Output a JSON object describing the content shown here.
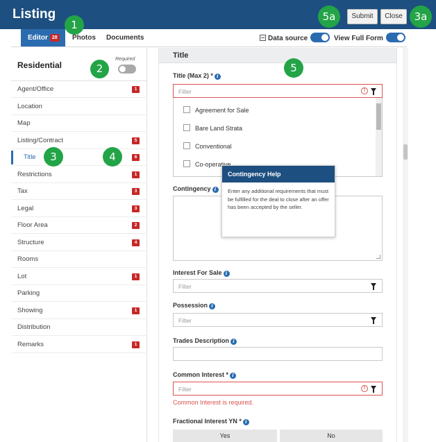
{
  "header": {
    "title": "Listing",
    "submit_label": "Submit",
    "close_label": "Close"
  },
  "tabs": [
    {
      "label": "Editor",
      "badge": "28"
    },
    {
      "label": "Photos"
    },
    {
      "label": "Documents"
    }
  ],
  "toggles": {
    "data_source_label": "Data source",
    "view_full_form_label": "View Full Form"
  },
  "sidebar": {
    "title": "Residential",
    "required_label": "Required",
    "items": [
      {
        "label": "Agent/Office",
        "badge": "1"
      },
      {
        "label": "Location",
        "badge": ""
      },
      {
        "label": "Map",
        "badge": ""
      },
      {
        "label": "Listing/Contract",
        "badge": "5"
      },
      {
        "label": "Title",
        "badge": "6"
      },
      {
        "label": "Restrictions",
        "badge": "1"
      },
      {
        "label": "Tax",
        "badge": "3"
      },
      {
        "label": "Legal",
        "badge": "3"
      },
      {
        "label": "Floor Area",
        "badge": "2"
      },
      {
        "label": "Structure",
        "badge": "4"
      },
      {
        "label": "Rooms",
        "badge": ""
      },
      {
        "label": "Lot",
        "badge": "1"
      },
      {
        "label": "Parking",
        "badge": ""
      },
      {
        "label": "Showing",
        "badge": "1"
      },
      {
        "label": "Distribution",
        "badge": ""
      },
      {
        "label": "Remarks",
        "badge": "1"
      }
    ]
  },
  "form": {
    "section_title": "Title",
    "title_field": {
      "label": "Title (Max 2) *",
      "placeholder": "Filter",
      "options": [
        "Agreement for Sale",
        "Bare Land Strata",
        "Conventional",
        "Co-operative"
      ]
    },
    "contingency_label": "Contingency",
    "interest_for_sale": {
      "label": "Interest For Sale",
      "placeholder": "Filter"
    },
    "possession": {
      "label": "Possession",
      "placeholder": "Filter"
    },
    "trades_description": {
      "label": "Trades Description"
    },
    "common_interest": {
      "label": "Common Interest *",
      "placeholder": "Filter",
      "error": "Common Interest is required."
    },
    "fractional_interest": {
      "label": "Fractional Interest YN *",
      "yes_label": "Yes",
      "no_label": "No"
    }
  },
  "popover": {
    "title": "Contingency Help",
    "body": "Enter any additional requirements that must be fulfilled for the deal to close after an offer has been accepted by the seller."
  },
  "markers": [
    "1",
    "2",
    "3",
    "4",
    "5",
    "5a",
    "3a"
  ],
  "colors": {
    "header": "#1d4f80",
    "accent": "#2b6cb0",
    "badge": "#c62828",
    "error": "#d9534f",
    "marker": "#22a447"
  }
}
